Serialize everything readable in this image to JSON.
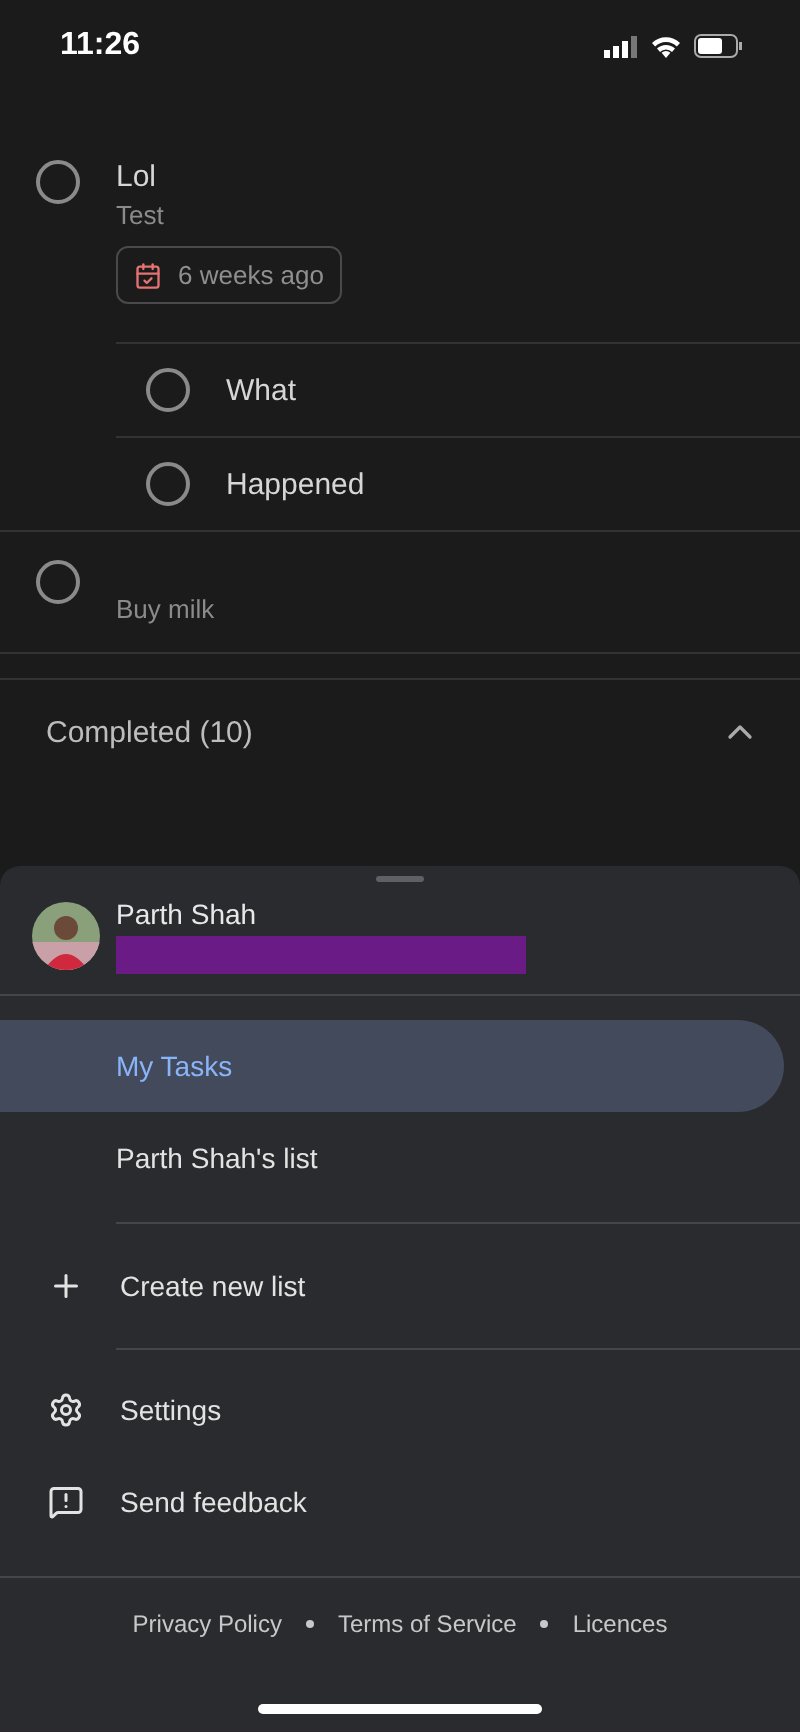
{
  "status_bar": {
    "time": "11:26"
  },
  "tasks": [
    {
      "title": "Lol",
      "notes": "Test",
      "date": "6 weeks ago",
      "completed": false,
      "subtasks": [
        {
          "title": "What",
          "completed": false
        },
        {
          "title": "Happened",
          "completed": false
        }
      ]
    },
    {
      "notes": "Buy milk",
      "completed": false
    }
  ],
  "completed_section": {
    "label": "Completed (10)",
    "expanded": true
  },
  "drawer": {
    "account": {
      "name": "Parth Shah"
    },
    "lists": [
      {
        "label": "My Tasks",
        "selected": true
      },
      {
        "label": "Parth Shah's list",
        "selected": false
      }
    ],
    "create": {
      "kind": "create",
      "label": "Create new list"
    },
    "actions": [
      {
        "kind": "settings",
        "label": "Settings"
      },
      {
        "kind": "feedback",
        "label": "Send feedback"
      }
    ],
    "footer_links": [
      "Privacy Policy",
      "Terms of Service",
      "Licences"
    ]
  }
}
